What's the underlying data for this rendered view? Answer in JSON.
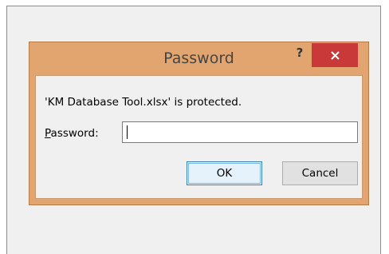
{
  "dialog": {
    "title": "Password",
    "help_label": "?",
    "message": "'KM Database Tool.xlsx' is protected.",
    "password_label_first": "P",
    "password_label_rest": "assword:",
    "password_value": "",
    "ok_label": "OK",
    "cancel_label": "Cancel"
  },
  "colors": {
    "titlebar": "#e3a56f",
    "close_button": "#c9393a",
    "default_button_border": "#3c7fb1"
  },
  "icons": {
    "help": "question-mark",
    "close": "x-mark"
  }
}
